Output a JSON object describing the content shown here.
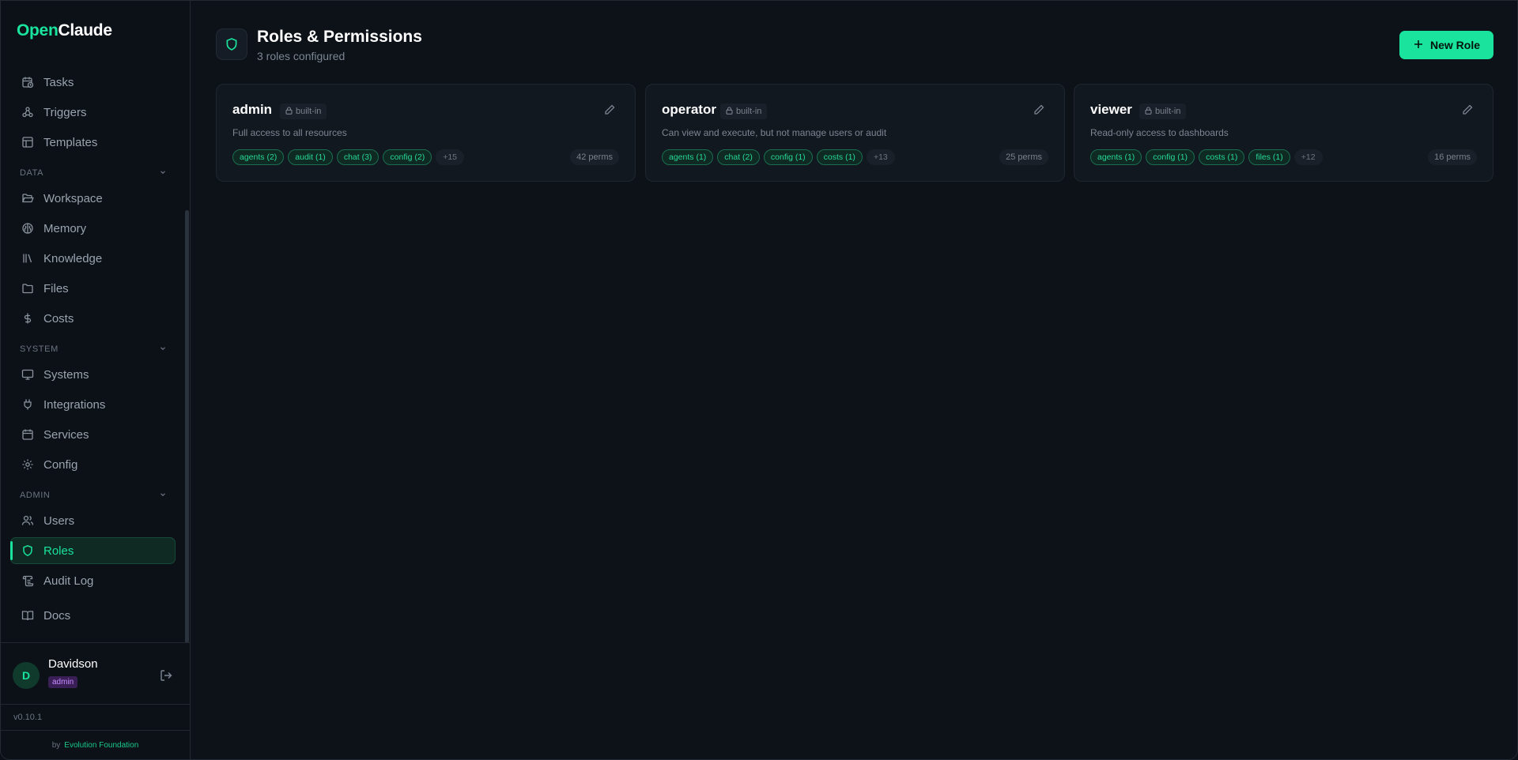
{
  "app": {
    "logo_part1": "Open",
    "logo_part2": "Claude",
    "accent_color": "#19e39c"
  },
  "sidebar": {
    "top_items": [
      {
        "label": "Tasks",
        "icon": "calendar-clock-icon"
      },
      {
        "label": "Triggers",
        "icon": "webhook-icon"
      },
      {
        "label": "Templates",
        "icon": "layout-template-icon"
      }
    ],
    "sections": [
      {
        "label": "DATA",
        "items": [
          {
            "label": "Workspace",
            "icon": "folder-open-icon"
          },
          {
            "label": "Memory",
            "icon": "brain-icon"
          },
          {
            "label": "Knowledge",
            "icon": "library-icon"
          },
          {
            "label": "Files",
            "icon": "folder-icon"
          },
          {
            "label": "Costs",
            "icon": "dollar-icon"
          }
        ]
      },
      {
        "label": "SYSTEM",
        "items": [
          {
            "label": "Systems",
            "icon": "monitor-icon"
          },
          {
            "label": "Integrations",
            "icon": "plug-icon"
          },
          {
            "label": "Services",
            "icon": "calendar-icon"
          },
          {
            "label": "Config",
            "icon": "gear-icon"
          }
        ]
      },
      {
        "label": "ADMIN",
        "items": [
          {
            "label": "Users",
            "icon": "users-icon"
          },
          {
            "label": "Roles",
            "icon": "shield-icon",
            "active": true
          },
          {
            "label": "Audit Log",
            "icon": "scroll-icon"
          }
        ]
      }
    ],
    "docs_label": "Docs",
    "user": {
      "initial": "D",
      "name": "Davidson",
      "role": "admin"
    },
    "version": "v0.10.1",
    "footer_by": "by",
    "footer_link": "Evolution Foundation"
  },
  "header": {
    "title": "Roles & Permissions",
    "subtitle": "3 roles configured",
    "new_role_label": "New Role"
  },
  "roles": [
    {
      "name": "admin",
      "badge": "built-in",
      "description": "Full access to all resources",
      "tags": [
        "agents (2)",
        "audit (1)",
        "chat (3)",
        "config (2)"
      ],
      "more": "+15",
      "perms": "42 perms"
    },
    {
      "name": "operator",
      "badge": "built-in",
      "description": "Can view and execute, but not manage users or audit",
      "tags": [
        "agents (1)",
        "chat (2)",
        "config (1)",
        "costs (1)"
      ],
      "more": "+13",
      "perms": "25 perms"
    },
    {
      "name": "viewer",
      "badge": "built-in",
      "description": "Read-only access to dashboards",
      "tags": [
        "agents (1)",
        "config (1)",
        "costs (1)",
        "files (1)"
      ],
      "more": "+12",
      "perms": "16 perms"
    }
  ]
}
